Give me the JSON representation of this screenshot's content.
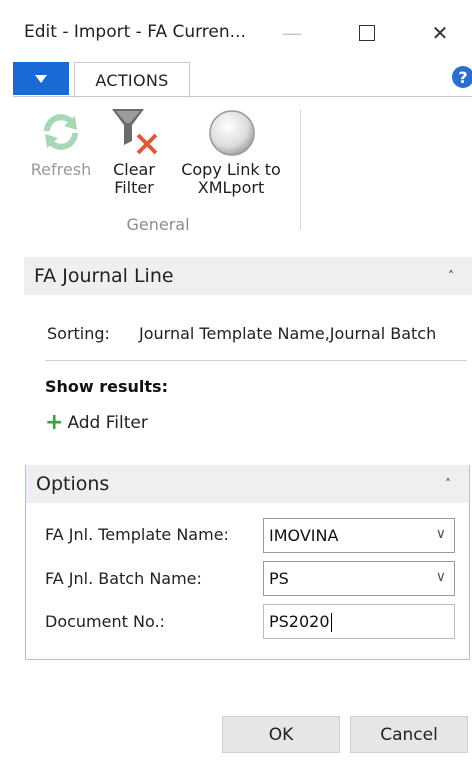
{
  "window": {
    "title": "Edit - Import - FA Curren...",
    "minimize": "—",
    "close": "✕"
  },
  "ribbon": {
    "tab": "ACTIONS",
    "help": "?",
    "buttons": {
      "refresh": "Refresh",
      "clear_filter_line1": "Clear",
      "clear_filter_line2": "Filter",
      "copy_link_line1": "Copy Link to",
      "copy_link_line2": "XMLport"
    },
    "group_label": "General"
  },
  "journal_section": {
    "title": "FA Journal Line",
    "sorting_label": "Sorting:",
    "sorting_value": "Journal Template Name,Journal Batch",
    "show_results": "Show results:",
    "add_filter": "Add Filter"
  },
  "options_section": {
    "title": "Options",
    "fields": {
      "template_label": "FA Jnl. Template Name:",
      "template_value": "IMOVINA",
      "batch_label": "FA Jnl. Batch Name:",
      "batch_value": "PS",
      "doc_label": "Document No.:",
      "doc_value": "PS2020"
    }
  },
  "dialog": {
    "ok": "OK",
    "cancel": "Cancel"
  },
  "icons": {
    "chevron_up": "˄",
    "chevron_down": "∨",
    "plus": "+"
  },
  "colors": {
    "accent": "#1a6ad6",
    "refresh_disabled": "#a6d7b6",
    "clear_x": "#e05a3a",
    "plus": "#38a148",
    "options_border": "#a8c4e8"
  }
}
